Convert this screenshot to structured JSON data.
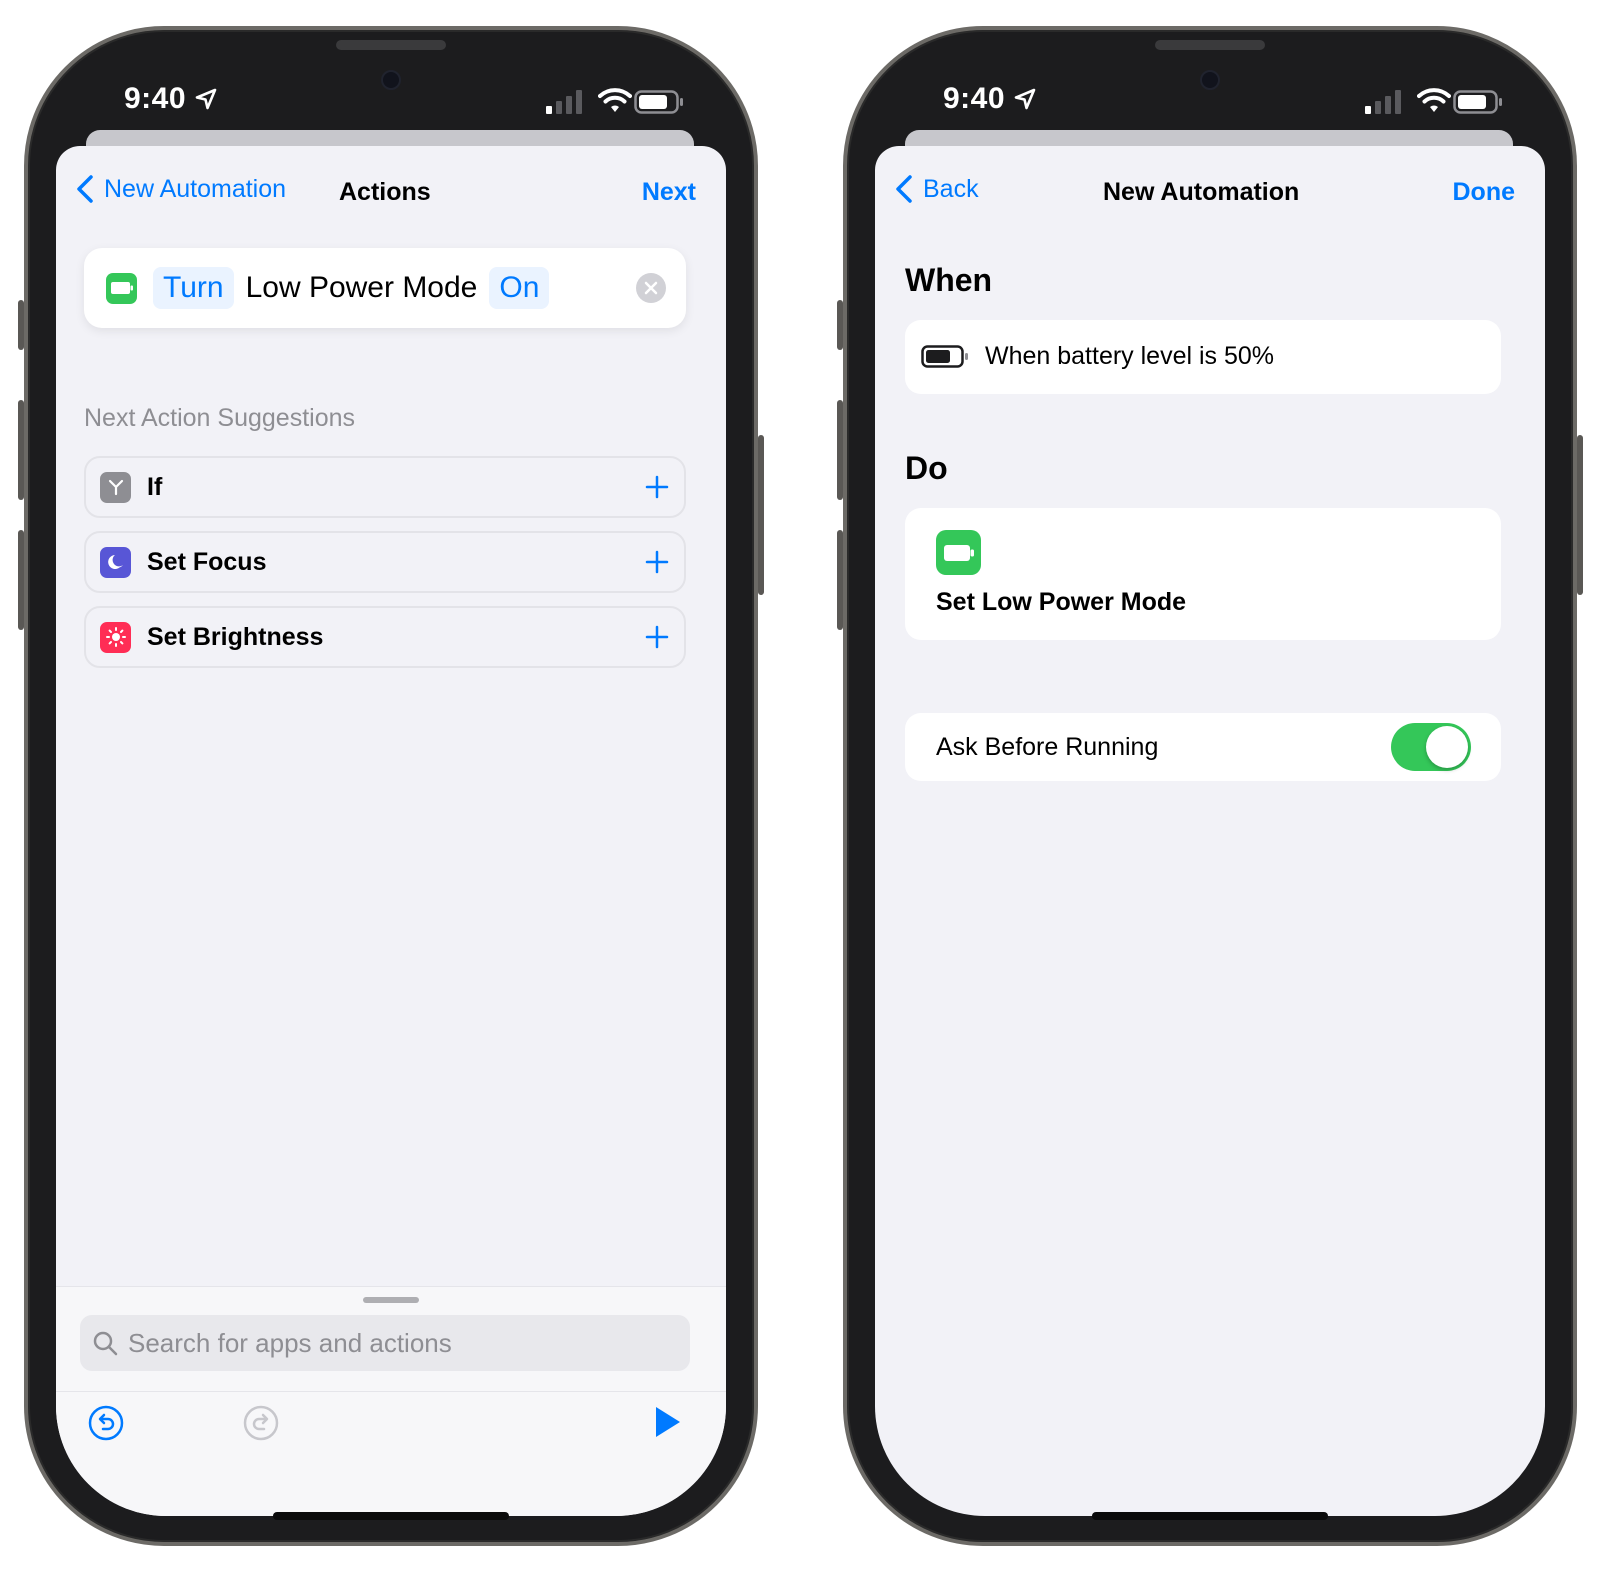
{
  "left": {
    "status": {
      "time": "9:40"
    },
    "nav": {
      "back_label": "New Automation",
      "title": "Actions",
      "action_label": "Next"
    },
    "action": {
      "verb": "Turn",
      "subject": "Low Power Mode",
      "state": "On"
    },
    "section_label": "Next Action Suggestions",
    "suggestions": [
      {
        "label": "If",
        "icon": "branch-icon",
        "color": "#8e8e93"
      },
      {
        "label": "Set Focus",
        "icon": "moon-icon",
        "color": "#5856d6"
      },
      {
        "label": "Set Brightness",
        "icon": "sun-icon",
        "color": "#ff2d55"
      }
    ],
    "search": {
      "placeholder": "Search for apps and actions"
    }
  },
  "right": {
    "status": {
      "time": "9:40"
    },
    "nav": {
      "back_label": "Back",
      "title": "New Automation",
      "action_label": "Done"
    },
    "when_heading": "When",
    "trigger_text": "When battery level is 50%",
    "do_heading": "Do",
    "do_action_label": "Set Low Power Mode",
    "ask_label": "Ask Before Running",
    "ask_enabled": true
  },
  "colors": {
    "accent": "#007aff",
    "green": "#34c759",
    "background": "#f2f2f7"
  }
}
